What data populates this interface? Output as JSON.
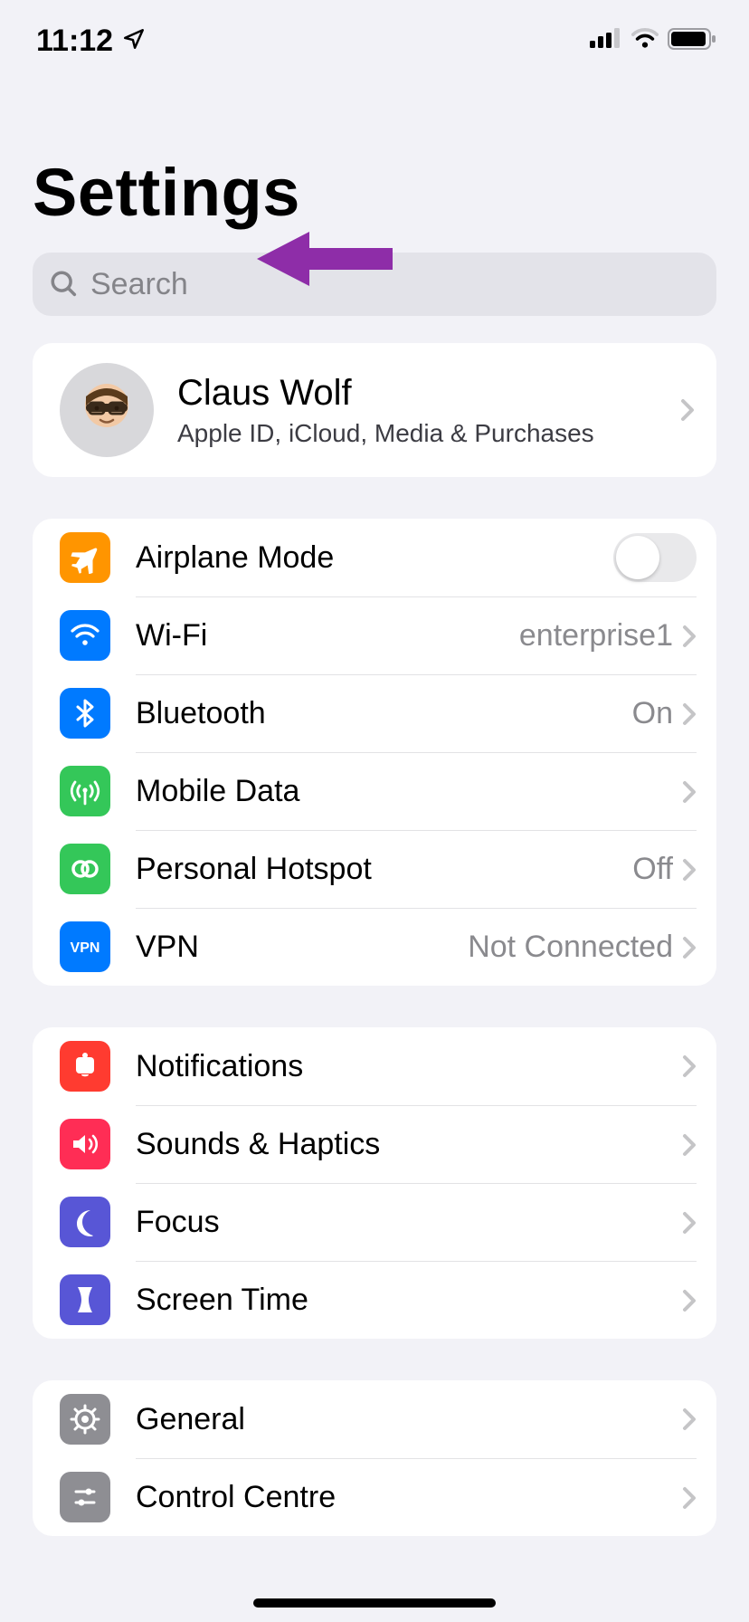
{
  "status": {
    "time": "11:12"
  },
  "page_title": "Settings",
  "search": {
    "placeholder": "Search"
  },
  "profile": {
    "name": "Claus Wolf",
    "subtitle": "Apple ID, iCloud, Media & Purchases"
  },
  "groups": [
    {
      "rows": [
        {
          "icon": "airplane",
          "icon_color": "#ff9500",
          "label": "Airplane Mode",
          "value": "",
          "toggle": true,
          "toggle_on": false
        },
        {
          "icon": "wifi",
          "icon_color": "#007aff",
          "label": "Wi-Fi",
          "value": "enterprise1"
        },
        {
          "icon": "bluetooth",
          "icon_color": "#007aff",
          "label": "Bluetooth",
          "value": "On"
        },
        {
          "icon": "antenna",
          "icon_color": "#34c759",
          "label": "Mobile Data",
          "value": ""
        },
        {
          "icon": "hotspot",
          "icon_color": "#34c759",
          "label": "Personal Hotspot",
          "value": "Off"
        },
        {
          "icon": "vpn",
          "icon_color": "#007aff",
          "label": "VPN",
          "value": "Not Connected"
        }
      ]
    },
    {
      "rows": [
        {
          "icon": "notifications",
          "icon_color": "#ff3b30",
          "label": "Notifications",
          "value": ""
        },
        {
          "icon": "sounds",
          "icon_color": "#ff2d55",
          "label": "Sounds & Haptics",
          "value": ""
        },
        {
          "icon": "focus",
          "icon_color": "#5856d6",
          "label": "Focus",
          "value": ""
        },
        {
          "icon": "screentime",
          "icon_color": "#5856d6",
          "label": "Screen Time",
          "value": ""
        }
      ]
    },
    {
      "rows": [
        {
          "icon": "general",
          "icon_color": "#8e8e93",
          "label": "General",
          "value": ""
        },
        {
          "icon": "controlcentre",
          "icon_color": "#8e8e93",
          "label": "Control Centre",
          "value": ""
        }
      ]
    }
  ]
}
